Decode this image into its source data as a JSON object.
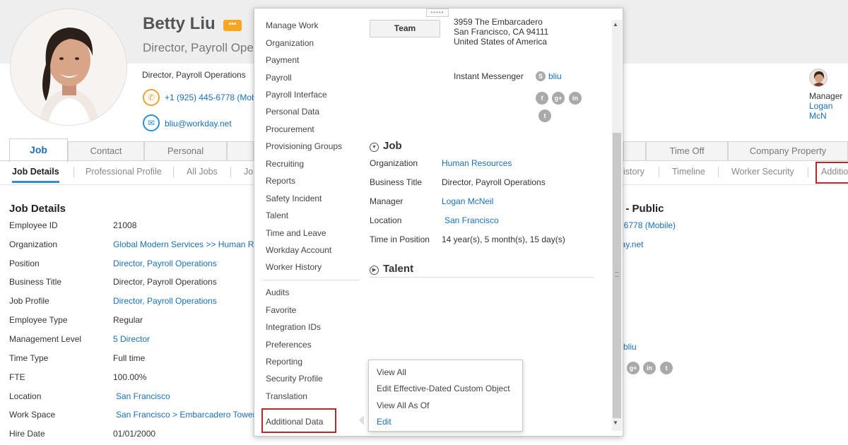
{
  "worker": {
    "name": "Betty Liu",
    "related_icon": "related-actions-icon",
    "title_big": "Director, Payroll Ope",
    "title_small": "Director, Payroll Operations",
    "phone": "+1 (925) 445-6778 (Mob",
    "email": "bliu@workday.net"
  },
  "manager_card": {
    "label": "Manager",
    "name": "Logan McN"
  },
  "tabs": {
    "job": "Job",
    "contact": "Contact",
    "personal": "Personal",
    "time_off": "Time Off",
    "company_property": "Company Property"
  },
  "subtabs": {
    "job_details": "Job Details",
    "professional_profile": "Professional Profile",
    "all_jobs": "All Jobs",
    "jo_partial": "Jo",
    "history_partial": "istory",
    "timeline": "Timeline",
    "worker_security": "Worker Security",
    "additional": "Additio"
  },
  "job_details": {
    "title": "Job Details",
    "rows": [
      {
        "label": "Employee ID",
        "value": "21008"
      },
      {
        "label": "Organization",
        "value": "Global Modern Services >> Human Re"
      },
      {
        "label": "Position",
        "value": "Director, Payroll Operations"
      },
      {
        "label": "Business Title",
        "value": "Director, Payroll Operations"
      },
      {
        "label": "Job Profile",
        "value": "Director, Payroll Operations"
      },
      {
        "label": "Employee Type",
        "value": "Regular"
      },
      {
        "label": "Management Level",
        "value": "5 Director"
      },
      {
        "label": "Time Type",
        "value": "Full time"
      },
      {
        "label": "FTE",
        "value": "100.00%"
      },
      {
        "label": "Location",
        "value": "San Francisco"
      },
      {
        "label": "Work Space",
        "value": "San Francisco > Embarcadero Tower"
      },
      {
        "label": "Hire Date",
        "value": "01/01/2000"
      }
    ]
  },
  "right_partial": {
    "title": "n - Public",
    "phone": "5-6778 (Mobile)",
    "email": "day.net",
    "im": "bliu"
  },
  "menu": {
    "items": [
      "Manage Work",
      "Organization",
      "Payment",
      "Payroll",
      "Payroll Interface",
      "Personal Data",
      "Procurement",
      "Provisioning Groups",
      "Recruiting",
      "Reports",
      "Safety Incident",
      "Talent",
      "Time and Leave",
      "Workday Account",
      "Worker History"
    ],
    "items2": [
      "Audits",
      "Favorite",
      "Integration IDs",
      "Preferences",
      "Reporting",
      "Security Profile",
      "Translation",
      "Additional Data"
    ]
  },
  "contact_panel": {
    "team_button": "Team",
    "address_lines": [
      "3959 The Embarcadero",
      "San Francisco, CA 94111",
      "United States of America"
    ],
    "im_label": "Instant Messenger",
    "im_value": "bliu"
  },
  "job_section": {
    "heading": "Job",
    "rows": [
      {
        "label": "Organization",
        "value": "Human Resources"
      },
      {
        "label": "Business Title",
        "value": "Director, Payroll Operations"
      },
      {
        "label": "Manager",
        "value": "Logan McNeil"
      },
      {
        "label": "Location",
        "value": "San Francisco"
      },
      {
        "label": "Time in Position",
        "value": "14 year(s), 5 month(s), 15 day(s)"
      }
    ]
  },
  "talent_section": {
    "heading": "Talent"
  },
  "submenu": {
    "items": [
      "View All",
      "Edit Effective-Dated Custom Object",
      "View All As Of",
      "Edit"
    ]
  },
  "colors": {
    "link": "#1a6fb5",
    "highlight": "#b22a2a",
    "related": "#f5a623"
  }
}
